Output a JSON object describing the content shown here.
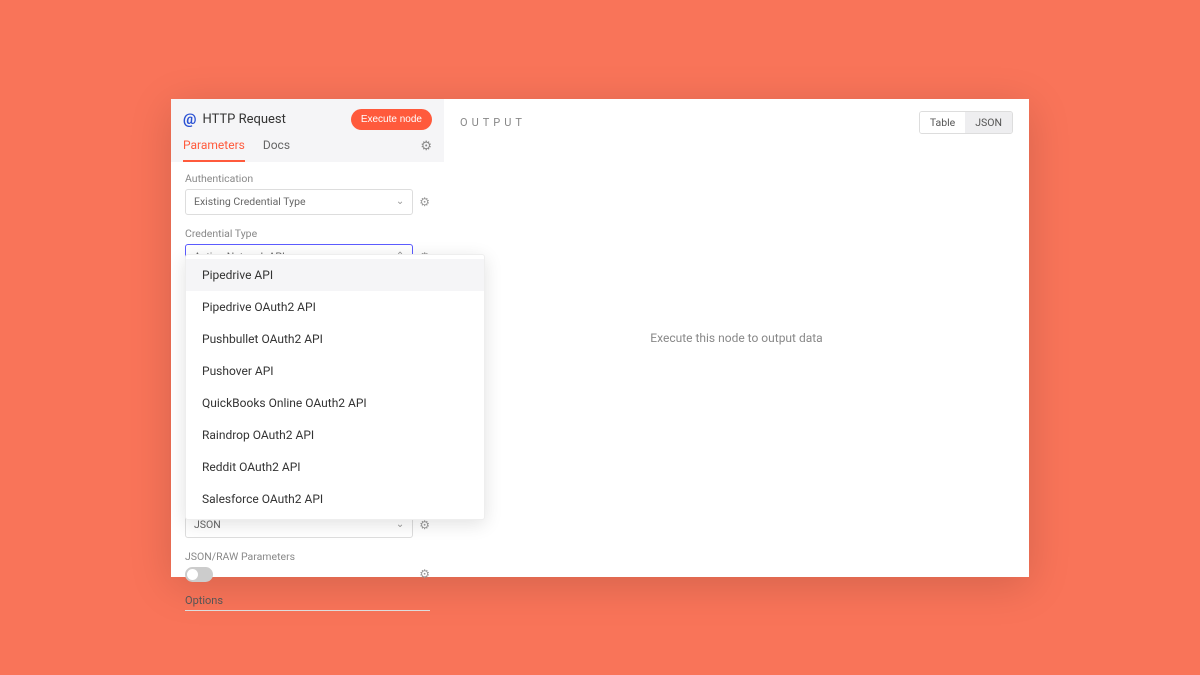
{
  "header": {
    "title": "HTTP Request",
    "execute_label": "Execute node"
  },
  "tabs": {
    "parameters": "Parameters",
    "docs": "Docs"
  },
  "fields": {
    "authentication": {
      "label": "Authentication",
      "value": "Existing Credential Type"
    },
    "credential_type": {
      "label": "Credential Type",
      "value": "Action Network API"
    },
    "json": {
      "value": "JSON"
    },
    "json_raw": {
      "label": "JSON/RAW Parameters"
    },
    "options": "Options"
  },
  "dropdown": {
    "items": [
      "Pipedrive API",
      "Pipedrive OAuth2 API",
      "Pushbullet OAuth2 API",
      "Pushover API",
      "QuickBooks Online OAuth2 API",
      "Raindrop OAuth2 API",
      "Reddit OAuth2 API",
      "Salesforce OAuth2 API"
    ]
  },
  "output": {
    "title": "OUTPUT",
    "table": "Table",
    "json": "JSON",
    "empty": "Execute this node to output data"
  }
}
